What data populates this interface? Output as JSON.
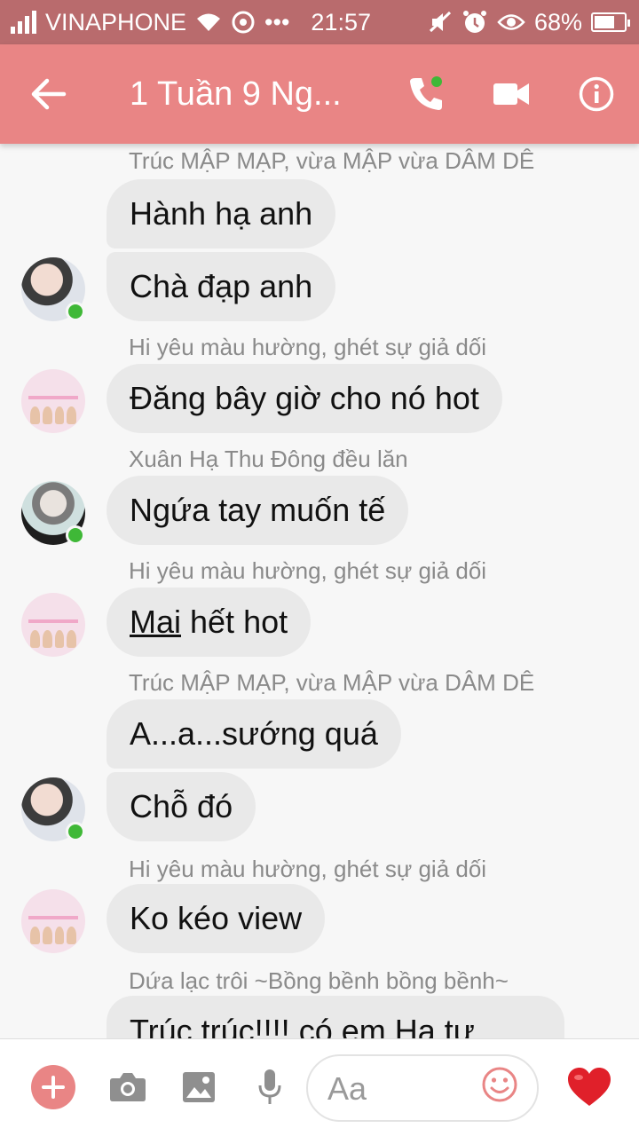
{
  "status_bar": {
    "carrier": "VINAPHONE",
    "dots": "•••",
    "time": "21:57",
    "battery": "68%"
  },
  "header": {
    "title": "1 Tuần 9 Ng...",
    "colors": {
      "statusbar": "#b96b6d",
      "appbar": "#e98585"
    }
  },
  "messages": [
    {
      "sender": "Trúc MẬP MẠP, vừa MẬP vừa DÂM DÊ",
      "lines": [
        "Hành hạ anh",
        "Chà đạp anh"
      ]
    },
    {
      "sender": "Hi yêu màu hường, ghét sự giả dối",
      "lines": [
        "Đăng bây giờ cho nó hot"
      ]
    },
    {
      "sender": "Xuân Hạ Thu Đông đều lăn",
      "lines": [
        "Ngứa tay muốn tế"
      ]
    },
    {
      "sender": "Hi yêu màu hường, ghét sự giả dối",
      "lines": [
        "Mai",
        " hết hot"
      ]
    },
    {
      "sender": "Trúc MẬP MẠP, vừa MẬP vừa DÂM DÊ",
      "lines": [
        "A...a...sướng quá",
        "Chỗ đó"
      ]
    },
    {
      "sender": "Hi yêu màu hường, ghét sự giả dối",
      "lines": [
        "Ko kéo view"
      ]
    },
    {
      "sender": "Dứa lạc trôi ~Bồng bềnh bồng bềnh~",
      "lines": [
        "Trúc trúc!!!! có em Hạ tự"
      ]
    }
  ],
  "composer": {
    "placeholder": "Aa"
  }
}
